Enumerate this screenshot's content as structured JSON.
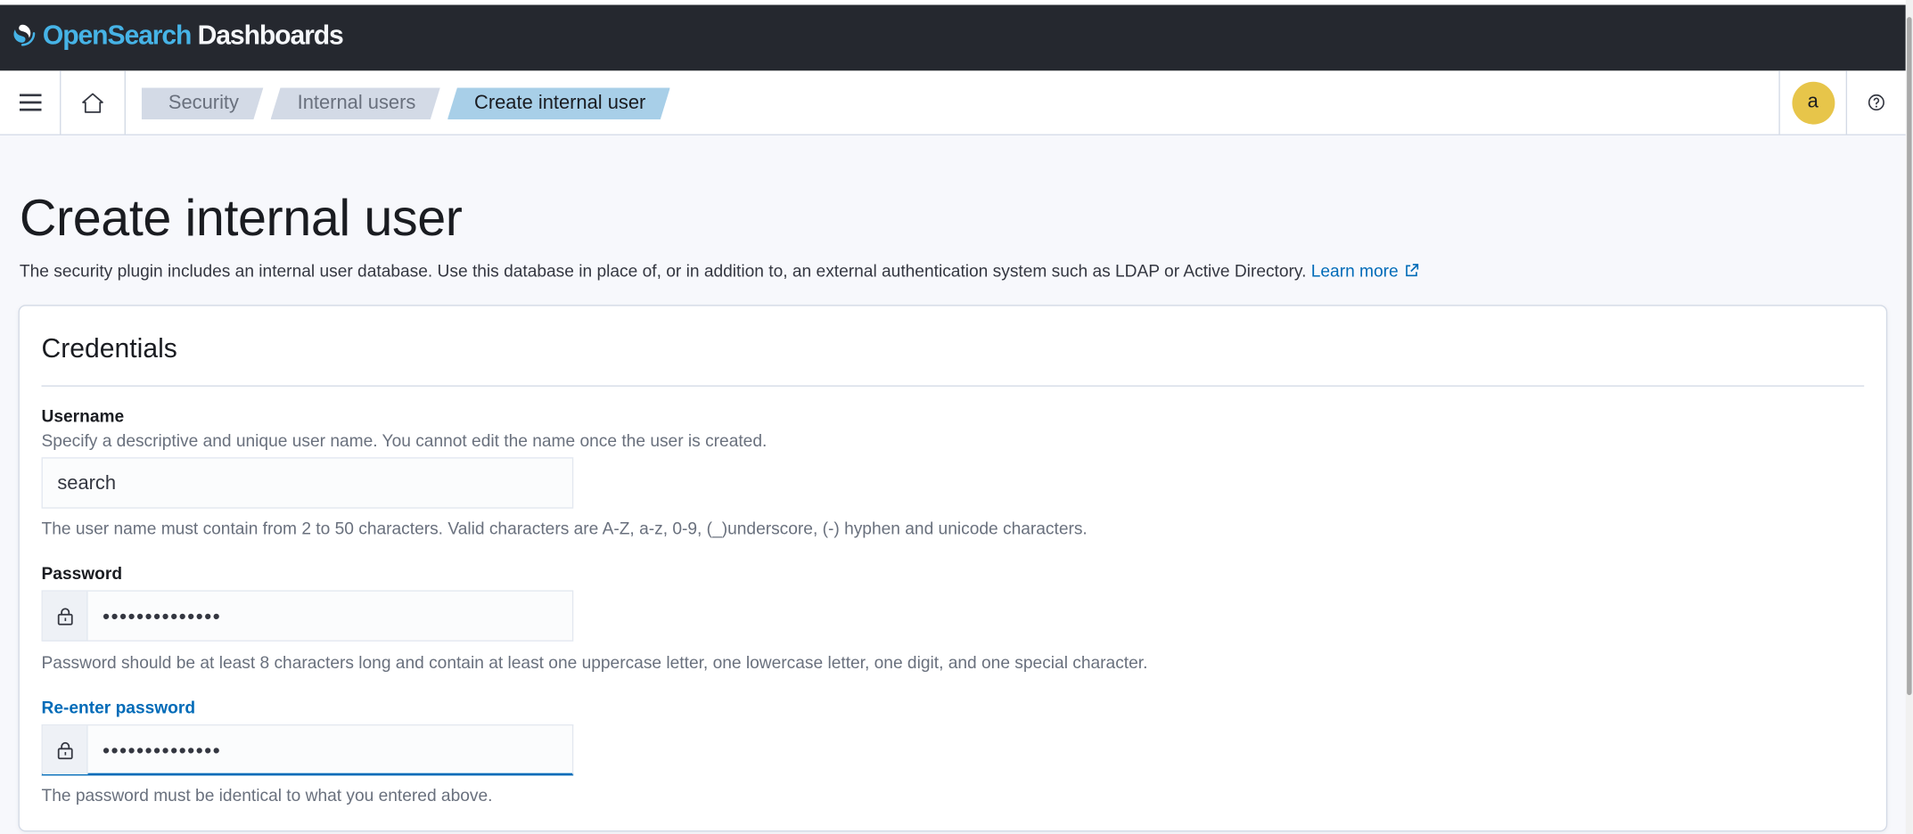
{
  "header": {
    "brand_prefix": "Open",
    "brand_middle": "Search",
    "brand_suffix": " Dashboards"
  },
  "nav": {
    "menu_icon": "hamburger-menu-icon",
    "home_icon": "home-icon",
    "breadcrumbs": [
      "Security",
      "Internal users",
      "Create internal user"
    ],
    "avatar_initial": "a",
    "help_icon": "help-icon"
  },
  "page": {
    "title": "Create internal user",
    "description": "The security plugin includes an internal user database. Use this database in place of, or in addition to, an external authentication system such as LDAP or Active Directory.",
    "learn_more": "Learn more"
  },
  "credentials": {
    "title": "Credentials",
    "username": {
      "label": "Username",
      "description": "Specify a descriptive and unique user name. You cannot edit the name once the user is created.",
      "value": "search",
      "help": "The user name must contain from 2 to 50 characters. Valid characters are A-Z, a-z, 0-9, (_)underscore, (-) hyphen and unicode characters."
    },
    "password": {
      "label": "Password",
      "value": "••••••••••••••",
      "help": "Password should be at least 8 characters long and contain at least one uppercase letter, one lowercase letter, one digit, and one special character."
    },
    "reenter_password": {
      "label": "Re-enter password",
      "value": "••••••••••••••",
      "help": "The password must be identical to what you entered above."
    }
  },
  "colors": {
    "header_bg": "#25282f",
    "accent": "#006bb8",
    "brand_blue": "#46b3e6",
    "avatar_bg": "#e7c54a",
    "active_crumb": "#a8cfe8"
  }
}
